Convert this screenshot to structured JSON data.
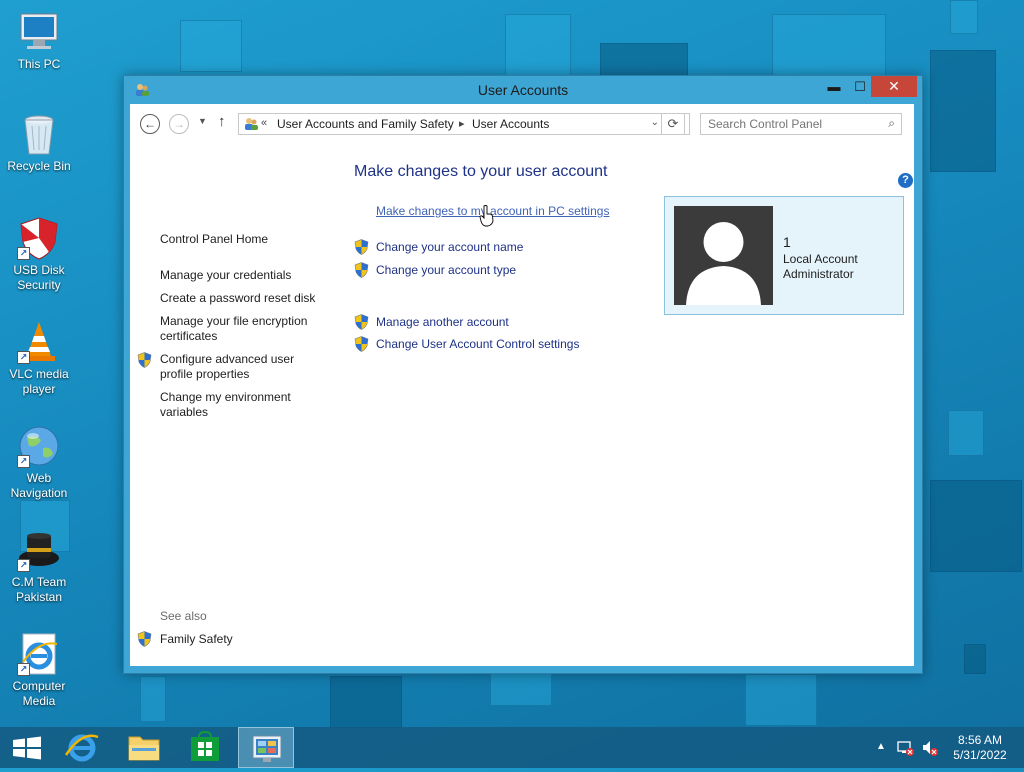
{
  "desktop": {
    "icons": [
      {
        "label": "This PC",
        "icon": "monitor-icon"
      },
      {
        "label": "Recycle Bin",
        "icon": "recycle-bin-icon"
      },
      {
        "label": "USB Disk Security",
        "icon": "shield-icon"
      },
      {
        "label": "VLC media player",
        "icon": "vlc-cone-icon"
      },
      {
        "label": "Web Navigation",
        "icon": "globe-icon"
      },
      {
        "label": "C.M Team Pakistan",
        "icon": "cm-hat-icon"
      },
      {
        "label": "Computer Media",
        "icon": "internet-explorer-icon"
      }
    ]
  },
  "window": {
    "title": "User Accounts",
    "controls": {
      "minimize": "▬",
      "maximize": "☐",
      "close": "✕"
    },
    "address": {
      "prefix": "«",
      "crumbs": [
        "User Accounts and Family Safety",
        "User Accounts"
      ],
      "separator": "▸"
    },
    "search": {
      "placeholder": "Search Control Panel"
    },
    "help": "?"
  },
  "left_pane": {
    "home": "Control Panel Home",
    "links": [
      {
        "label": "Manage your credentials",
        "shield": false
      },
      {
        "label": "Create a password reset disk",
        "shield": false
      },
      {
        "label": "Manage your file encryption certificates",
        "shield": false
      },
      {
        "label": "Configure advanced user profile properties",
        "shield": true
      },
      {
        "label": "Change my environment variables",
        "shield": false
      }
    ],
    "see_also": "See also",
    "family_safety": "Family Safety"
  },
  "main": {
    "heading": "Make changes to your user account",
    "pc_settings_link": "Make changes to my account in PC settings",
    "links": [
      {
        "label": "Change your account name",
        "shield": true
      },
      {
        "label": "Change your account type",
        "shield": true
      },
      {
        "label": "Manage another account",
        "shield": true
      },
      {
        "label": "Change User Account Control settings",
        "shield": true
      }
    ]
  },
  "account": {
    "name": "1",
    "type": "Local Account",
    "role": "Administrator"
  },
  "taskbar": {
    "pinned": [
      "start-icon",
      "internet-explorer-icon",
      "file-explorer-icon",
      "store-icon",
      "control-panel-icon"
    ],
    "time": "8:56 AM",
    "date": "5/31/2022",
    "tray_arrow": "▲"
  },
  "colors": {
    "link": "#1e3287",
    "window_frame": "#3ea6d5",
    "close_button": "#c7463a",
    "desktop": "#1689bd"
  }
}
